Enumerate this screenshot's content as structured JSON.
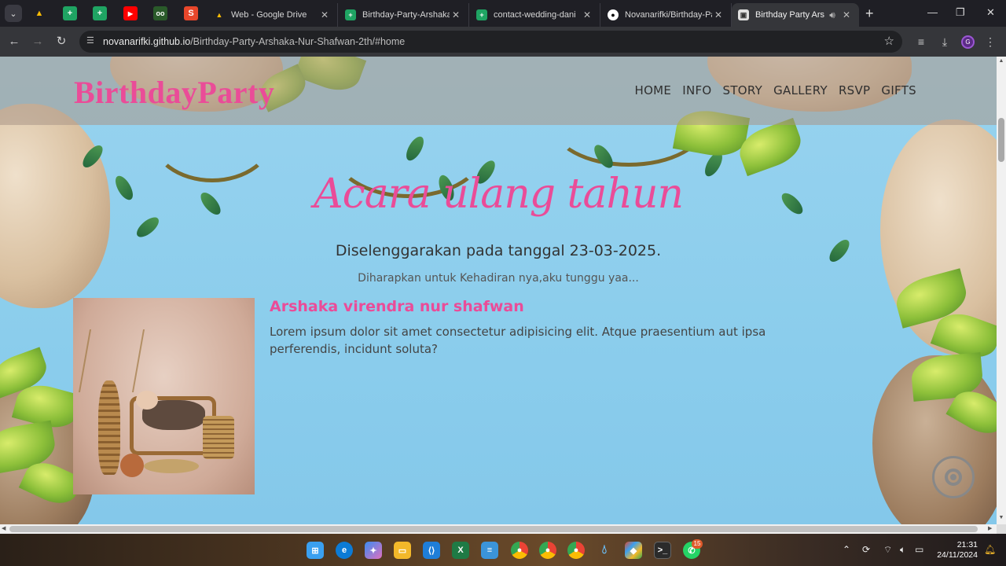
{
  "browser": {
    "tabs": [
      {
        "title": "Web - Google Drive",
        "icon": "google-drive-icon",
        "color": "#1a73e8"
      },
      {
        "title": "Birthday-Party-Arshaka-",
        "icon": "google-sheets-icon",
        "color": "#1fa463"
      },
      {
        "title": "contact-wedding-dani",
        "icon": "google-sheets-icon",
        "color": "#1fa463"
      },
      {
        "title": "Novanarifki/Birthday-Pa",
        "icon": "github-icon",
        "color": "#ffffff"
      },
      {
        "title": "Birthday Party Arsha",
        "icon": "page-icon",
        "color": "#e0e0e0",
        "active": true
      }
    ],
    "url_host": "novanarifki.github.io",
    "url_path": "/Birthday-Party-Arshaka-Nur-Shafwan-2th/#home",
    "profile_initial": "G"
  },
  "page": {
    "brand": "BirthdayParty",
    "menu": [
      "HOME",
      "INFO",
      "STORY",
      "GALLERY",
      "RSVP",
      "GIFTS"
    ],
    "hero_title": "Acara ulang tahun",
    "hero_subtitle": "Diselenggarakan pada tanggal 23-03-2025.",
    "hero_note": "Diharapkan untuk Kehadiran nya,aku tunggu yaa...",
    "person_name": "Arshaka virendra nur shafwan",
    "person_description": "Lorem ipsum dolor sit amet consectetur adipisicing elit. Atque praesentium aut ipsa perferendis, incidunt soluta?",
    "accent_color": "#ea4c98"
  },
  "taskbar": {
    "apps": [
      "windows-start-icon",
      "edge-icon",
      "copilot-icon",
      "file-explorer-icon",
      "vscode-icon",
      "excel-icon",
      "notepad-icon",
      "chrome-icon",
      "chrome-icon",
      "chrome-icon",
      "drop-icon",
      "git-icon",
      "terminal-icon",
      "whatsapp-icon"
    ],
    "whatsapp_badge": "15",
    "time": "21:31",
    "date": "24/11/2024"
  }
}
